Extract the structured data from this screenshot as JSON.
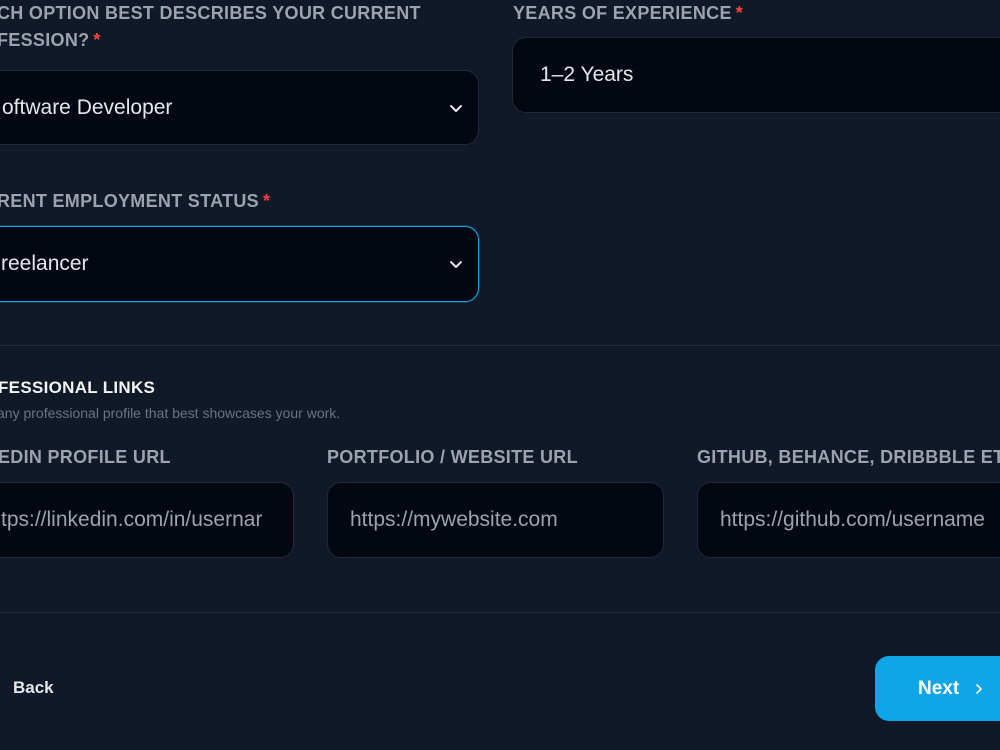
{
  "profession": {
    "label": "WHICH OPTION BEST DESCRIBES YOUR CURRENT PROFESSION?",
    "label_line1": "CH OPTION BEST DESCRIBES YOUR CURRENT",
    "label_line2": "FESSION?",
    "required_mark": "*",
    "value": "oftware Developer"
  },
  "experience": {
    "label": "YEARS OF EXPERIENCE",
    "required_mark": "*",
    "value": "1–2 Years"
  },
  "employment": {
    "label": "RENT EMPLOYMENT STATUS",
    "required_mark": "*",
    "value": "reelancer"
  },
  "links_section": {
    "title": "FESSIONAL LINKS",
    "subtitle": "any professional profile that best showcases your work."
  },
  "links": {
    "linkedin": {
      "label": "EDIN PROFILE URL",
      "placeholder": "tps://linkedin.com/in/usernar"
    },
    "portfolio": {
      "label": "PORTFOLIO / WEBSITE URL",
      "placeholder": "https://mywebsite.com"
    },
    "github": {
      "label": "GITHUB, BEHANCE, DRIBBBLE ETC",
      "placeholder": "https://github.com/username"
    }
  },
  "nav": {
    "back_label": "Back",
    "next_label": "Next"
  },
  "colors": {
    "background": "#111827",
    "field_bg": "#030712",
    "accent": "#0ea5e9",
    "required": "#ef4444"
  },
  "icons": {
    "select_chevron": "chevron-down-icon",
    "next_arrow": "chevron-right-icon"
  }
}
